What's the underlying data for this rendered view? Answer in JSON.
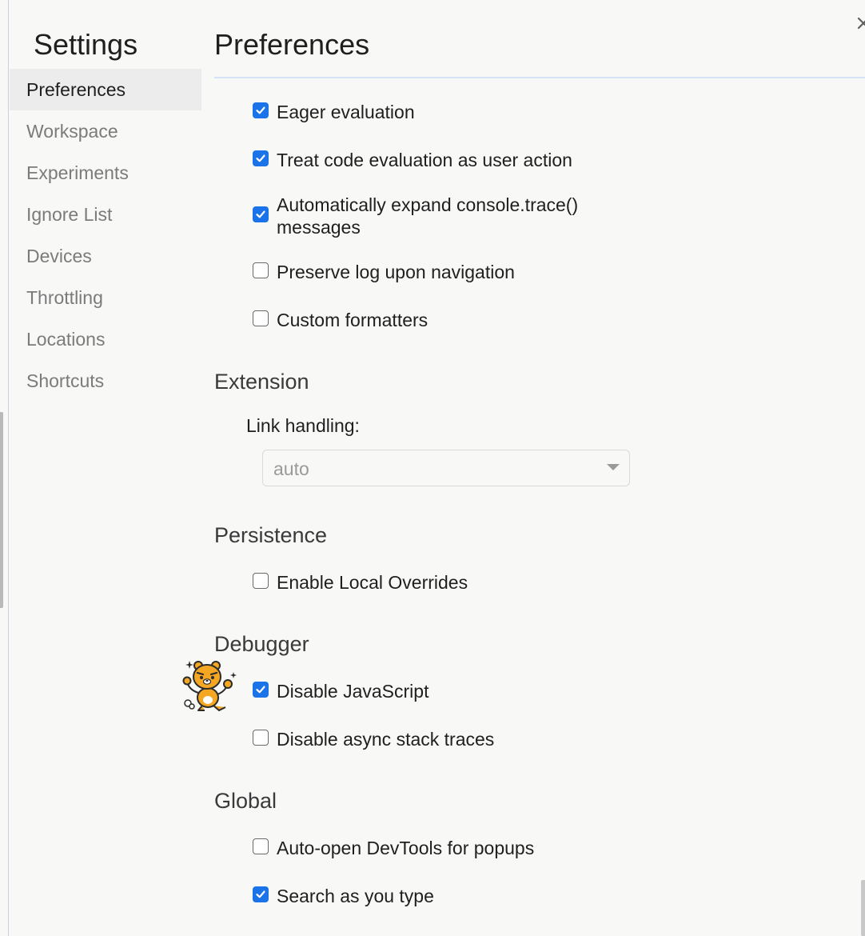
{
  "sidebar": {
    "title": "Settings",
    "items": [
      {
        "label": "Preferences",
        "active": true
      },
      {
        "label": "Workspace",
        "active": false
      },
      {
        "label": "Experiments",
        "active": false
      },
      {
        "label": "Ignore List",
        "active": false
      },
      {
        "label": "Devices",
        "active": false
      },
      {
        "label": "Throttling",
        "active": false
      },
      {
        "label": "Locations",
        "active": false
      },
      {
        "label": "Shortcuts",
        "active": false
      }
    ]
  },
  "main": {
    "title": "Preferences",
    "console_options": [
      {
        "label": "Eager evaluation",
        "checked": true
      },
      {
        "label": "Treat code evaluation as user action",
        "checked": true
      },
      {
        "label": "Automatically expand console.trace() messages",
        "checked": true
      },
      {
        "label": "Preserve log upon navigation",
        "checked": false
      },
      {
        "label": "Custom formatters",
        "checked": false
      }
    ],
    "extension": {
      "heading": "Extension",
      "link_handling_label": "Link handling:",
      "link_handling_value": "auto"
    },
    "persistence": {
      "heading": "Persistence",
      "options": [
        {
          "label": "Enable Local Overrides",
          "checked": false
        }
      ]
    },
    "debugger": {
      "heading": "Debugger",
      "options": [
        {
          "label": "Disable JavaScript",
          "checked": true
        },
        {
          "label": "Disable async stack traces",
          "checked": false
        }
      ]
    },
    "global": {
      "heading": "Global",
      "options": [
        {
          "label": "Auto-open DevTools for popups",
          "checked": false
        },
        {
          "label": "Search as you type",
          "checked": true
        }
      ]
    }
  },
  "icons": {
    "close": "close-icon",
    "checkbox_checked": "checkmark-icon",
    "select_arrow": "chevron-down-icon",
    "sticker": "bear-mascot-icon"
  },
  "colors": {
    "accent": "#1a73e8",
    "background": "#f8f8f7",
    "active_nav": "#ececec",
    "muted_text": "#7b7b7b",
    "divider": "#d5e1f7"
  }
}
